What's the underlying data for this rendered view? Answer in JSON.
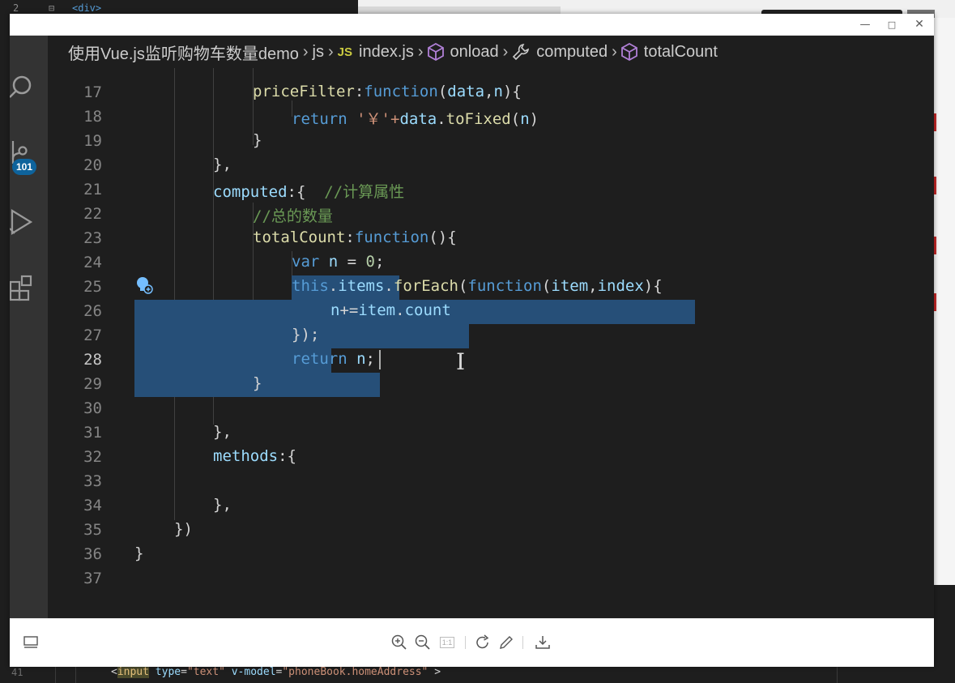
{
  "background": {
    "top_line_number": "2",
    "top_line_tag": "<div>",
    "bottom_line_number": "41",
    "bottom_code": {
      "open": "<",
      "tag": "input",
      "attr1": " type",
      "eq1": "=",
      "val1": "\"text\"",
      "attr2": " v-model",
      "eq2": "=",
      "val2": "\"phoneBook.homeAddress\"",
      "close": " >"
    }
  },
  "viewer": {
    "window_buttons": {
      "minimize": "—",
      "maximize": "□",
      "close": "✕"
    },
    "toolbar": [
      {
        "name": "zoom-in-button",
        "icon": "zoom-in-icon"
      },
      {
        "name": "zoom-out-button",
        "icon": "zoom-out-icon"
      },
      {
        "name": "actual-size-button",
        "icon": "actual-size-icon",
        "label": "1:1"
      },
      {
        "name": "rotate-button",
        "icon": "rotate-icon"
      },
      {
        "name": "edit-button",
        "icon": "pencil-icon"
      },
      {
        "name": "download-button",
        "icon": "download-icon"
      }
    ]
  },
  "activity_bar": {
    "items": [
      "search-icon",
      "source-control-icon",
      "run-debug-icon",
      "extensions-icon"
    ],
    "source_control_badge": "101"
  },
  "breadcrumb": {
    "folder": "使用Vue.js监听购物车数量demo",
    "subfolder": "js",
    "file_badge": "JS",
    "file": "index.js",
    "symbol1": "onload",
    "symbol2": "computed",
    "symbol3": "totalCount"
  },
  "editor": {
    "active_line": "28",
    "lines": [
      {
        "n": "17",
        "tokens": {
          "a": "priceFilter",
          "b": ":",
          "c": "function",
          "d": "(",
          "e": "data",
          "f": ",",
          "g": "n",
          "h": "){"
        }
      },
      {
        "n": "18",
        "tokens": {
          "a": "return",
          "b": " '",
          "c": "￥",
          "d": "'+",
          "e": "data",
          "f": ".",
          "g": "toFixed",
          "h": "(",
          "i": "n",
          "j": ")"
        }
      },
      {
        "n": "19",
        "text": "}"
      },
      {
        "n": "20",
        "text": "},"
      },
      {
        "n": "21",
        "tokens": {
          "a": "computed",
          "b": ":{  ",
          "c": "//计算属性"
        }
      },
      {
        "n": "22",
        "comment": "//总的数量"
      },
      {
        "n": "23",
        "tokens": {
          "a": "totalCount",
          "b": ":",
          "c": "function",
          "d": "(){"
        }
      },
      {
        "n": "24",
        "tokens": {
          "a": "var",
          "b": " n",
          "c": " = ",
          "d": "0",
          "e": ";"
        }
      },
      {
        "n": "25",
        "tokens": {
          "a": "this",
          "b": ".",
          "c": "items",
          "d": ".",
          "e": "forEach",
          "f": "(",
          "g": "function",
          "h": "(",
          "i": "item",
          "j": ",",
          "k": "index",
          "l": "){"
        }
      },
      {
        "n": "26",
        "tokens": {
          "a": "n",
          "b": "+=",
          "c": "item",
          "d": ".",
          "e": "count"
        }
      },
      {
        "n": "27",
        "text": "});"
      },
      {
        "n": "28",
        "tokens": {
          "a": "return",
          "b": " n",
          "c": ";"
        }
      },
      {
        "n": "29",
        "text": "}"
      },
      {
        "n": "30",
        "text": ""
      },
      {
        "n": "31",
        "text": "},"
      },
      {
        "n": "32",
        "tokens": {
          "a": "methods",
          "b": ":{"
        }
      },
      {
        "n": "33",
        "text": ""
      },
      {
        "n": "34",
        "text": "},"
      },
      {
        "n": "35",
        "text": "})"
      },
      {
        "n": "36",
        "text": "}"
      },
      {
        "n": "37",
        "text": ""
      }
    ]
  }
}
